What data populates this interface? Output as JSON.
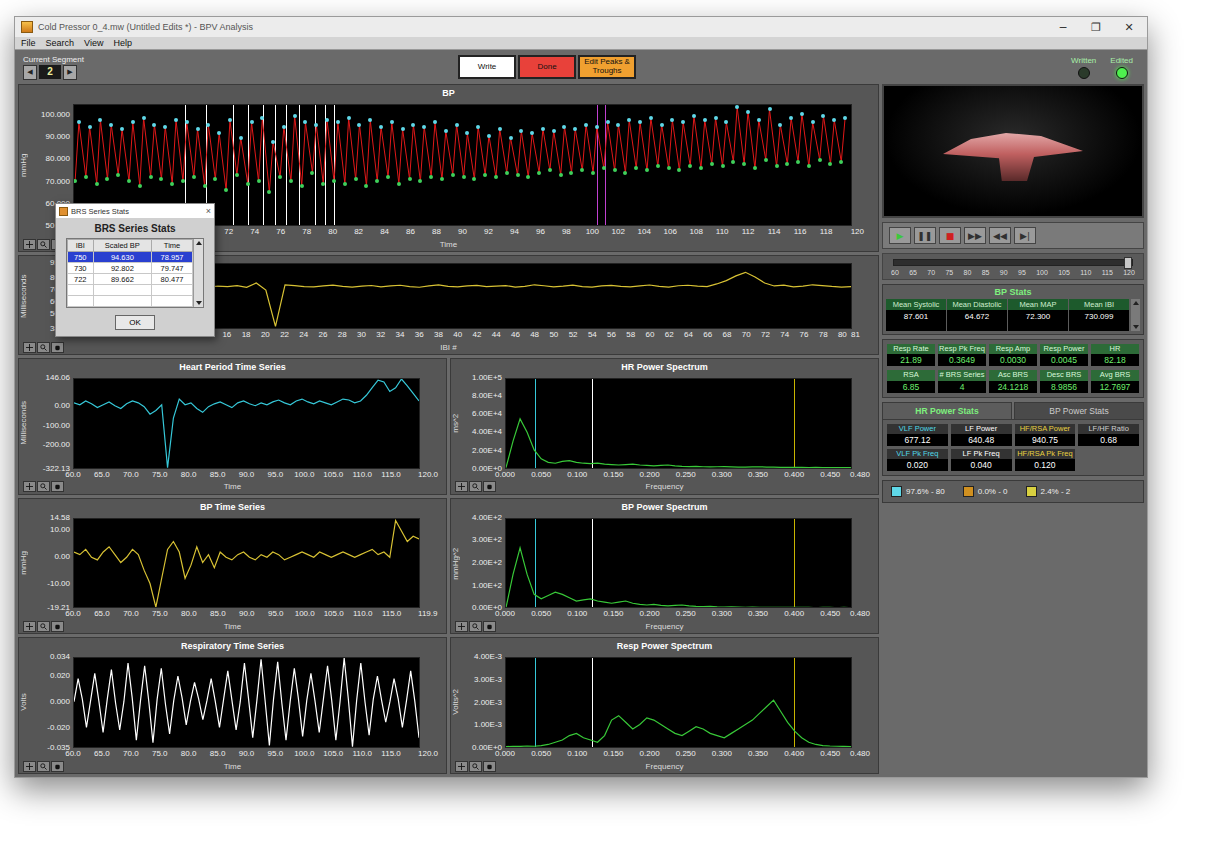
{
  "window": {
    "title": "Cold Pressor 0_4.mw (Untitled Edits *) - BPV Analysis",
    "controls": [
      "─",
      "❐",
      "✕"
    ]
  },
  "menu": [
    "File",
    "Search",
    "View",
    "Help"
  ],
  "segment": {
    "label": "Current Segment",
    "value": "2",
    "prev": "◀",
    "next": "▶"
  },
  "actions": [
    {
      "label": "Write",
      "color": "#ffffff"
    },
    {
      "label": "Done",
      "color": "#e8413a"
    },
    {
      "label": "Edit Peaks & Troughs",
      "color": "#f0a030"
    }
  ],
  "indicators": [
    {
      "label": "Written",
      "on": false
    },
    {
      "label": "Edited",
      "on": true
    }
  ],
  "bp_chart": {
    "title": "BP",
    "y_label": "mmHg",
    "y_ticks": [
      "100.000",
      "90.000",
      "80.000",
      "70.000",
      "60.000",
      "50.000"
    ],
    "x_ticks": [
      "60",
      "62",
      "64",
      "66",
      "68",
      "70",
      "72",
      "74",
      "76",
      "78",
      "80",
      "82",
      "84",
      "86",
      "88",
      "90",
      "92",
      "94",
      "96",
      "98",
      "100",
      "102",
      "104",
      "106",
      "108",
      "110",
      "112",
      "114",
      "116",
      "118",
      "120"
    ],
    "x_label": "Time",
    "color": "#e01818",
    "peak_color": "#5fd8e8",
    "trough_color": "#3ed05a",
    "systolic": [
      97,
      95,
      98,
      96,
      94,
      97,
      99,
      96,
      95,
      98,
      97,
      94,
      96,
      92,
      98,
      90,
      97,
      99,
      88,
      95,
      100,
      97,
      96,
      98,
      97,
      99,
      96,
      98,
      95,
      97,
      94,
      96,
      95,
      97,
      93,
      96,
      92,
      95,
      91,
      94,
      90,
      93,
      92,
      94,
      93,
      95,
      94,
      96,
      95,
      97,
      96,
      98,
      97,
      99,
      96,
      98,
      97,
      100,
      98,
      99,
      97,
      104,
      102,
      98,
      103,
      96,
      99,
      101,
      97,
      100,
      98,
      99
    ],
    "diastolic": [
      70,
      72,
      69,
      71,
      73,
      70,
      68,
      72,
      71,
      69,
      70,
      72,
      68,
      71,
      66,
      73,
      69,
      70,
      65,
      72,
      70,
      68,
      74,
      69,
      70,
      69,
      71,
      68,
      70,
      72,
      69,
      71,
      70,
      72,
      71,
      73,
      72,
      71,
      73,
      72,
      74,
      73,
      72,
      74,
      75,
      73,
      74,
      75,
      74,
      76,
      75,
      74,
      76,
      75,
      77,
      76,
      75,
      77,
      76,
      78,
      77,
      79,
      78,
      76,
      80,
      77,
      78,
      79,
      77,
      80,
      78,
      79
    ],
    "markers": [
      {
        "time": 68.6,
        "color": "#ffffff"
      },
      {
        "time": 70.2,
        "color": "#ffffff"
      },
      {
        "time": 72.3,
        "color": "#ffffff"
      },
      {
        "time": 73.4,
        "color": "#ffffff"
      },
      {
        "time": 74.6,
        "color": "#ffffff"
      },
      {
        "time": 75.5,
        "color": "#ffffff"
      },
      {
        "time": 76.4,
        "color": "#ffffff"
      },
      {
        "time": 77.4,
        "color": "#ffffff"
      },
      {
        "time": 78.6,
        "color": "#ffffff"
      },
      {
        "time": 79.4,
        "color": "#ffffff"
      },
      {
        "time": 80.1,
        "color": "#ffffff"
      },
      {
        "time": 100.4,
        "color": "#c040d0"
      },
      {
        "time": 101.0,
        "color": "#c040d0"
      }
    ]
  },
  "ibi_chart": {
    "y_label": "Milliseconds",
    "y_ticks": [
      "920.0",
      "800.0",
      "700.0",
      "600.0",
      "500.0",
      "381.0"
    ],
    "x_ticks": [
      "0",
      "2",
      "4",
      "6",
      "8",
      "10",
      "12",
      "14",
      "16",
      "18",
      "20",
      "22",
      "24",
      "26",
      "28",
      "30",
      "32",
      "34",
      "36",
      "38",
      "40",
      "42",
      "44",
      "46",
      "48",
      "50",
      "52",
      "54",
      "56",
      "58",
      "60",
      "62",
      "64",
      "66",
      "68",
      "70",
      "72",
      "74",
      "76",
      "78",
      "80",
      "81"
    ],
    "x_label": "IBI #",
    "series": [
      {
        "color": "#d8c234",
        "values": [
          720,
          735,
          728,
          740,
          732,
          725,
          738,
          730,
          722,
          745,
          736,
          728,
          731,
          742,
          726,
          734,
          729,
          737,
          724,
          760,
          700,
          395,
          745,
          738,
          730,
          728,
          735,
          742,
          731,
          726,
          733,
          739,
          728,
          735,
          741,
          730,
          724,
          736,
          744,
          732,
          727,
          735,
          740,
          729,
          733,
          738,
          726,
          731,
          745,
          737,
          728,
          734,
          742,
          730,
          725,
          736,
          740,
          732,
          728,
          735,
          743,
          731,
          726,
          737,
          741,
          733,
          729,
          752,
          780,
          820,
          850,
          810,
          760,
          735,
          742,
          728,
          733,
          745,
          738,
          731,
          726,
          730
        ]
      }
    ]
  },
  "time_series": [
    {
      "title": "Heart Period Time Series",
      "y_label": "Milliseconds",
      "y_ticks": [
        "146.06",
        "0.00",
        "-100.00",
        "-200.00",
        "-322.13"
      ],
      "x_ticks": [
        "60.0",
        "65.0",
        "70.0",
        "75.0",
        "80.0",
        "85.0",
        "90.0",
        "95.0",
        "100.0",
        "105.0",
        "110.0",
        "115.0",
        "120.0"
      ],
      "x_label": "Time",
      "series": [
        {
          "color": "#36c8d8",
          "values": [
            20,
            10,
            30,
            15,
            -5,
            10,
            25,
            5,
            -10,
            15,
            30,
            20,
            0,
            -40,
            -20,
            10,
            -322,
            -60,
            40,
            10,
            20,
            -10,
            -30,
            0,
            15,
            25,
            10,
            -5,
            20,
            30,
            15,
            5,
            20,
            10,
            25,
            35,
            20,
            10,
            30,
            40,
            25,
            15,
            30,
            20,
            10,
            25,
            40,
            35,
            20,
            30,
            60,
            100,
            140,
            130,
            80,
            100,
            146,
            110,
            70,
            30
          ]
        }
      ]
    },
    {
      "title": "BP Time Series",
      "y_label": "mmHg",
      "y_ticks": [
        "14.58",
        "10.00",
        "0.00",
        "-10.00",
        "-19.21"
      ],
      "x_ticks": [
        "60.0",
        "65.0",
        "70.0",
        "75.0",
        "80.0",
        "85.0",
        "90.0",
        "95.0",
        "100.0",
        "105.0",
        "110.0",
        "115.0",
        "119.9"
      ],
      "x_label": "Time",
      "series": [
        {
          "color": "#d8c234",
          "values": [
            2,
            1,
            3,
            0,
            -1,
            2,
            4,
            1,
            -2,
            0,
            3,
            1,
            -5,
            -10,
            -19,
            -8,
            3,
            6,
            2,
            -8,
            -3,
            4,
            -2,
            1,
            -4,
            2,
            0,
            -1,
            1,
            2,
            0,
            -1,
            1,
            0,
            2,
            1,
            -1,
            0,
            1,
            2,
            1,
            0,
            2,
            1,
            0,
            1,
            2,
            1,
            0,
            1,
            2,
            3,
            1,
            2,
            0,
            14,
            10,
            6,
            8,
            7
          ]
        }
      ]
    },
    {
      "title": "Respiratory Time Series",
      "y_label": "Volts",
      "y_ticks": [
        "0.034",
        "0.020",
        "0.000",
        "-0.020",
        "-0.035"
      ],
      "x_ticks": [
        "60.0",
        "65.0",
        "70.0",
        "75.0",
        "80.0",
        "85.0",
        "90.0",
        "95.0",
        "100.0",
        "105.0",
        "110.0",
        "115.0",
        "120.0"
      ],
      "x_label": "Time",
      "series": [
        {
          "color": "#ffffff",
          "values": [
            0.0,
            0.018,
            0.002,
            -0.02,
            0.001,
            0.022,
            0.0,
            -0.024,
            0.002,
            0.025,
            -0.001,
            -0.022,
            0.0,
            0.03,
            0.003,
            -0.03,
            0.001,
            0.028,
            0.0,
            -0.032,
            0.002,
            0.026,
            -0.002,
            -0.025,
            0.001,
            0.02,
            0.003,
            -0.018,
            0.0,
            0.015,
            0.002,
            -0.014,
            0.001,
            0.018,
            0.0,
            -0.02,
            0.002,
            0.024,
            0.001,
            -0.022,
            0.0,
            0.03,
            0.002,
            -0.028,
            0.001,
            0.033,
            0.0,
            -0.034,
            0.002,
            0.031,
            -0.001,
            -0.03,
            0.0,
            0.026,
            0.002,
            -0.027,
            0.001,
            0.022,
            0.0,
            -0.024,
            0.002,
            0.028,
            0.001,
            -0.03,
            0.0,
            0.034,
            0.002,
            -0.035,
            0.001,
            0.03,
            0.0,
            -0.026,
            0.002,
            0.02,
            0.001,
            -0.016,
            0.0,
            0.018,
            0.002,
            -0.02,
            0.001,
            0.024,
            0.0,
            -0.028
          ]
        }
      ]
    }
  ],
  "spectra": [
    {
      "title": "HR Power Spectrum",
      "y_label": "ms^2",
      "y_ticks": [
        "1.00E+5",
        "8.00E+4",
        "6.00E+4",
        "4.00E+4",
        "2.00E+4",
        "0.00E+0"
      ],
      "x_ticks": [
        "0.000",
        "0.050",
        "0.100",
        "0.150",
        "0.200",
        "0.250",
        "0.300",
        "0.350",
        "0.400",
        "0.450",
        "0.480"
      ],
      "x_label": "Frequency",
      "bands": [
        {
          "freq": 0.04,
          "color": "#36c8d8"
        },
        {
          "freq": 0.12,
          "color": "#ffffff"
        },
        {
          "freq": 0.4,
          "color": "#c8b400"
        }
      ],
      "series": [
        {
          "color": "#38c838",
          "values": [
            0,
            30000,
            55000,
            40000,
            20000,
            10000,
            6000,
            5000,
            7000,
            8000,
            6000,
            5000,
            4500,
            5000,
            4000,
            3500,
            3000,
            3500,
            4000,
            3000,
            2500,
            2000,
            2500,
            3000,
            2000,
            1500,
            1200,
            1500,
            1000,
            800,
            1000,
            1200,
            900,
            700,
            600,
            800,
            900,
            700,
            500,
            400,
            300,
            400,
            300,
            200,
            300,
            200,
            150,
            100,
            120,
            80
          ]
        }
      ]
    },
    {
      "title": "BP Power Spectrum",
      "y_label": "mmHg^2",
      "y_ticks": [
        "4.00E+2",
        "3.00E+2",
        "2.00E+2",
        "1.00E+2",
        "0.00E+0"
      ],
      "x_ticks": [
        "0.000",
        "0.050",
        "0.100",
        "0.150",
        "0.200",
        "0.250",
        "0.300",
        "0.350",
        "0.400",
        "0.450",
        "0.480"
      ],
      "x_label": "Frequency",
      "bands": [
        {
          "freq": 0.04,
          "color": "#36c8d8"
        },
        {
          "freq": 0.12,
          "color": "#ffffff"
        },
        {
          "freq": 0.4,
          "color": "#c8b400"
        }
      ],
      "series": [
        {
          "color": "#38c838",
          "values": [
            0,
            150,
            270,
            150,
            60,
            40,
            55,
            70,
            60,
            45,
            30,
            35,
            40,
            30,
            25,
            20,
            25,
            30,
            20,
            15,
            12,
            15,
            10,
            8,
            10,
            12,
            8,
            6,
            5,
            6,
            4,
            3,
            4,
            3,
            2,
            3,
            2,
            1,
            2,
            1,
            1,
            2,
            1,
            1,
            0,
            1,
            1,
            0,
            1,
            0
          ]
        }
      ]
    },
    {
      "title": "Resp Power Spectrum",
      "y_label": "Volts^2",
      "y_ticks": [
        "4.00E-3",
        "3.00E-3",
        "2.00E-3",
        "1.00E-3",
        "0.00E+0"
      ],
      "x_ticks": [
        "0.000",
        "0.050",
        "0.100",
        "0.150",
        "0.200",
        "0.250",
        "0.300",
        "0.350",
        "0.400",
        "0.450",
        "0.480"
      ],
      "x_label": "Frequency",
      "bands": [
        {
          "freq": 0.04,
          "color": "#36c8d8"
        },
        {
          "freq": 0.12,
          "color": "#ffffff"
        },
        {
          "freq": 0.4,
          "color": "#c8b400"
        }
      ],
      "series": [
        {
          "color": "#38c838",
          "values": [
            0,
            2e-05,
            1e-05,
            3e-05,
            2e-05,
            5e-05,
            0.0001,
            0.0002,
            0.0003,
            0.0005,
            0.0006,
            0.0004,
            0.0003,
            0.0002,
            0.0005,
            0.0012,
            0.0014,
            0.0011,
            0.0008,
            0.001,
            0.0013,
            0.0012,
            0.001,
            0.0008,
            0.0006,
            0.0005,
            0.0007,
            0.0009,
            0.0008,
            0.0006,
            0.0005,
            0.0004,
            0.0006,
            0.0008,
            0.001,
            0.0012,
            0.0015,
            0.0018,
            0.0021,
            0.0016,
            0.0011,
            0.0007,
            0.0004,
            0.0002,
            0.0001,
            5e-05,
            3e-05,
            2e-05,
            1e-05,
            0
          ]
        }
      ]
    }
  ],
  "dialog": {
    "window_title": "BRS Series Stats",
    "close": "×",
    "heading": "BRS Series Stats",
    "columns": [
      "IBI",
      "Scaled BP",
      "Time"
    ],
    "rows": [
      {
        "cells": [
          "750",
          "94.630",
          "78.957"
        ],
        "selected": true
      },
      {
        "cells": [
          "730",
          "92.802",
          "79.747"
        ],
        "selected": false
      },
      {
        "cells": [
          "722",
          "89.662",
          "80.477"
        ],
        "selected": false
      },
      {
        "cells": [
          "",
          "",
          ""
        ],
        "selected": false
      },
      {
        "cells": [
          "",
          "",
          ""
        ],
        "selected": false
      }
    ],
    "button": "OK"
  },
  "player": {
    "controls": [
      {
        "symbol": "▶",
        "color": "#3cc83c"
      },
      {
        "symbol": "❚❚",
        "color": "#303030"
      },
      {
        "symbol": "■",
        "color": "#d02020"
      },
      {
        "symbol": "▶▶",
        "color": "#303030"
      },
      {
        "symbol": "◀◀",
        "color": "#303030"
      },
      {
        "symbol": "▶|",
        "color": "#303030"
      }
    ],
    "slider": {
      "level": 1,
      "ticks": [
        "60",
        "65",
        "70",
        "75",
        "80",
        "85",
        "90",
        "95",
        "100",
        "105",
        "110",
        "115",
        "120"
      ]
    }
  },
  "bp_stats": {
    "title": "BP Stats",
    "items": [
      {
        "label": "Mean Systolic",
        "value": "87.601"
      },
      {
        "label": "Mean Diastolic",
        "value": "64.672"
      },
      {
        "label": "Mean MAP",
        "value": "72.300"
      },
      {
        "label": "Mean IBI",
        "value": "730.099"
      }
    ]
  },
  "stats": [
    {
      "label": "Resp Rate",
      "value": "21.89"
    },
    {
      "label": "Resp Pk Freq",
      "value": "0.3649"
    },
    {
      "label": "Resp Amp",
      "value": "0.0030"
    },
    {
      "label": "Resp Power",
      "value": "0.0045"
    },
    {
      "label": "HR",
      "value": "82.18"
    },
    {
      "label": "RSA",
      "value": "6.85"
    },
    {
      "label": "# BRS Series",
      "value": "4"
    },
    {
      "label": "Asc BRS",
      "value": "24.1218"
    },
    {
      "label": "Desc BRS",
      "value": "8.9856"
    },
    {
      "label": "Avg BRS",
      "value": "12.7697"
    }
  ],
  "power_tabs": [
    {
      "label": "HR Power Stats",
      "selected": true
    },
    {
      "label": "BP Power Stats",
      "selected": false
    }
  ],
  "power_stats": [
    {
      "label": "VLF Power",
      "value": "677.12",
      "color": "#4fd8e8"
    },
    {
      "label": "LF Power",
      "value": "640.48",
      "color": "#ffffff"
    },
    {
      "label": "HF/RSA Power",
      "value": "940.75",
      "color": "#e8d040"
    },
    {
      "label": "LF/HF Ratio",
      "value": "0.68",
      "color": "#d0d0d0"
    },
    {
      "label": "VLF Pk Freq",
      "value": "0.020",
      "color": "#4fd8e8"
    },
    {
      "label": "LF Pk Freq",
      "value": "0.040",
      "color": "#ffffff"
    },
    {
      "label": "HF/RSA Pk Freq",
      "value": "0.120",
      "color": "#e8d040"
    }
  ],
  "legend": [
    {
      "label": "97.6% - 80",
      "color": "#5fd8e8"
    },
    {
      "label": "0.0% - 0",
      "color": "#d09020"
    },
    {
      "label": "2.4% - 2",
      "color": "#d8d040"
    }
  ]
}
